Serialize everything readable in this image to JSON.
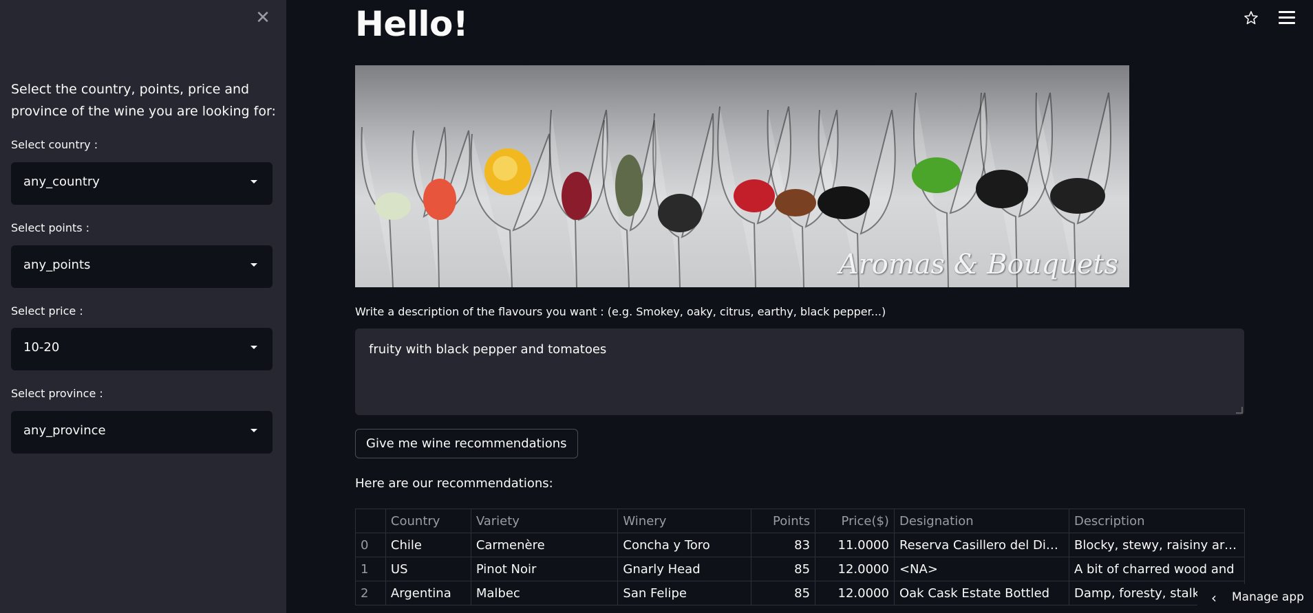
{
  "sidebar": {
    "intro": "Select the country, points, price and province of the wine you are looking for:",
    "country_label": "Select country :",
    "country_value": "any_country",
    "points_label": "Select points :",
    "points_value": "any_points",
    "price_label": "Select price :",
    "price_value": "10-20",
    "province_label": "Select province :",
    "province_value": "any_province"
  },
  "main": {
    "title": "Hello!",
    "banner_caption": "Aromas & Bouquets",
    "description_label": "Write a description of the flavours you want : (e.g. Smokey, oaky, citrus, earthy, black pepper...)",
    "description_value": "fruity with black pepper and tomatoes",
    "button_label": "Give me wine recommendations",
    "recommendations_label": "Here are our recommendations:"
  },
  "table": {
    "columns": [
      "",
      "Country",
      "Variety",
      "Winery",
      "Points",
      "Price($)",
      "Designation",
      "Description"
    ],
    "rows": [
      [
        "0",
        "Chile",
        "Carmenère",
        "Concha y Toro",
        "83",
        "11.0000",
        "Reserva Casillero del Diablo",
        "Blocky, stewy, raisiny aromas"
      ],
      [
        "1",
        "US",
        "Pinot Noir",
        "Gnarly Head",
        "85",
        "12.0000",
        "<NA>",
        "A bit of charred wood and"
      ],
      [
        "2",
        "Argentina",
        "Malbec",
        "San Felipe",
        "85",
        "12.0000",
        "Oak Cask Estate Bottled",
        "Damp, foresty, stalky"
      ]
    ]
  },
  "footer": {
    "manage_label": "Manage app"
  },
  "icons": {
    "close": "close-icon",
    "star": "star-icon",
    "menu": "hamburger-menu-icon",
    "caret": "chevron-down-icon",
    "back": "chevron-left-icon"
  }
}
